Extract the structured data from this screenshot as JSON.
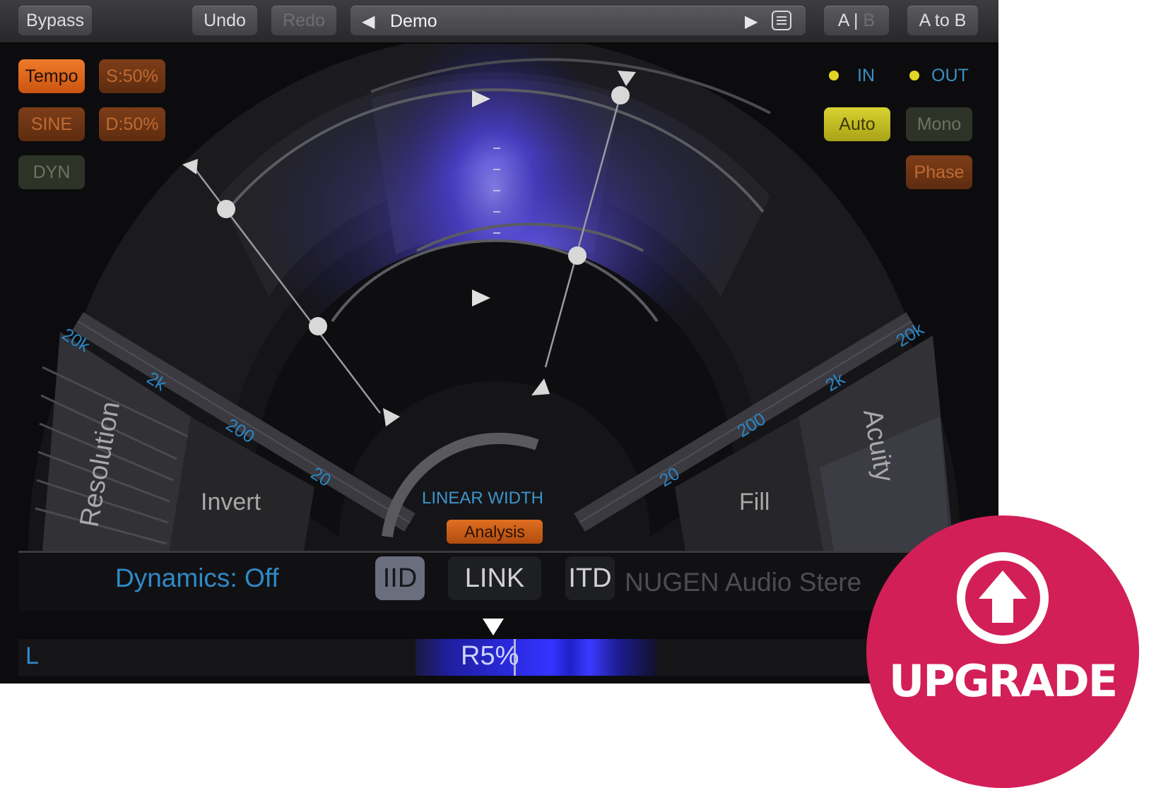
{
  "toolbar": {
    "bypass": "Bypass",
    "undo": "Undo",
    "redo": "Redo",
    "preset_name": "Demo",
    "ab_left": "A |",
    "ab_right": "B",
    "a_to_b": "A to B"
  },
  "left_buttons": {
    "tempo": "Tempo",
    "sync": "S:50%",
    "sine": "SINE",
    "depth": "D:50%",
    "dyn": "DYN"
  },
  "io": {
    "in": "IN",
    "out": "OUT"
  },
  "right_buttons": {
    "auto": "Auto",
    "mono": "Mono",
    "phase": "Phase"
  },
  "display": {
    "left_scale": [
      "20k",
      "2k",
      "200",
      "20"
    ],
    "right_scale": [
      "20k",
      "2k",
      "200",
      "20"
    ],
    "resolution": "Resolution",
    "invert": "Invert",
    "fill": "Fill",
    "acuity": "Acuity",
    "linear_width": "LINEAR WIDTH",
    "analysis": "Analysis"
  },
  "dynamics": {
    "label": "Dynamics: Off",
    "iid": "IID",
    "link": "LINK",
    "itd": "ITD",
    "brand": "NUGEN Audio Stere"
  },
  "meter": {
    "left_label": "L",
    "position": "R5%"
  },
  "upgrade": {
    "label": "UPGRADE"
  },
  "colors": {
    "accent_orange": "#e8701f",
    "blue_text": "#2e8ac9",
    "auto_yellow": "#cdc52a",
    "upgrade_bg": "#d21f58"
  }
}
